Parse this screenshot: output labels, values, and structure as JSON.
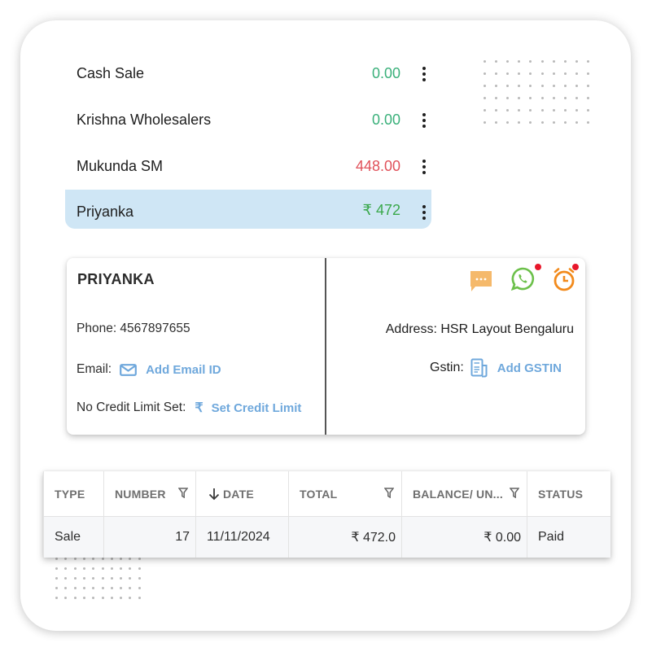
{
  "parties": [
    {
      "name": "Cash Sale",
      "amount": "0.00",
      "tone": "green",
      "selected": false
    },
    {
      "name": "Krishna Wholesalers",
      "amount": "0.00",
      "tone": "green",
      "selected": false
    },
    {
      "name": "Mukunda SM",
      "amount": "448.00",
      "tone": "red",
      "selected": false
    },
    {
      "name": "Priyanka",
      "amount": "₹ 472",
      "tone": "rupee",
      "selected": true
    }
  ],
  "detail": {
    "name": "PRIYANKA",
    "phone_label": "Phone: 4567897655",
    "email_label": "Email:",
    "add_email": "Add Email ID",
    "credit_label": "No Credit Limit Set:",
    "set_credit": "Set Credit Limit",
    "address_label": "Address: HSR Layout Bengaluru",
    "gstin_label": "Gstin:",
    "add_gstin": "Add GSTIN",
    "icons": [
      "chat-icon",
      "whatsapp-icon",
      "reminder-alarm-icon"
    ]
  },
  "table": {
    "headers": [
      "TYPE",
      "NUMBER",
      "DATE",
      "TOTAL",
      "BALANCE/ UN...",
      "STATUS"
    ],
    "rows": [
      [
        "Sale",
        "17",
        "11/11/2024",
        "₹ 472.0",
        "₹ 0.00",
        "Paid"
      ]
    ]
  },
  "colors": {
    "positive": "#3ab07a",
    "negative": "#e0515a",
    "selected_row": "#cfe6f5",
    "link": "#6fa8dc",
    "chat_icon": "#f5b96b",
    "whatsapp_icon": "#6cc04a",
    "alarm_icon": "#f28a1c",
    "badge": "#e8172b"
  }
}
